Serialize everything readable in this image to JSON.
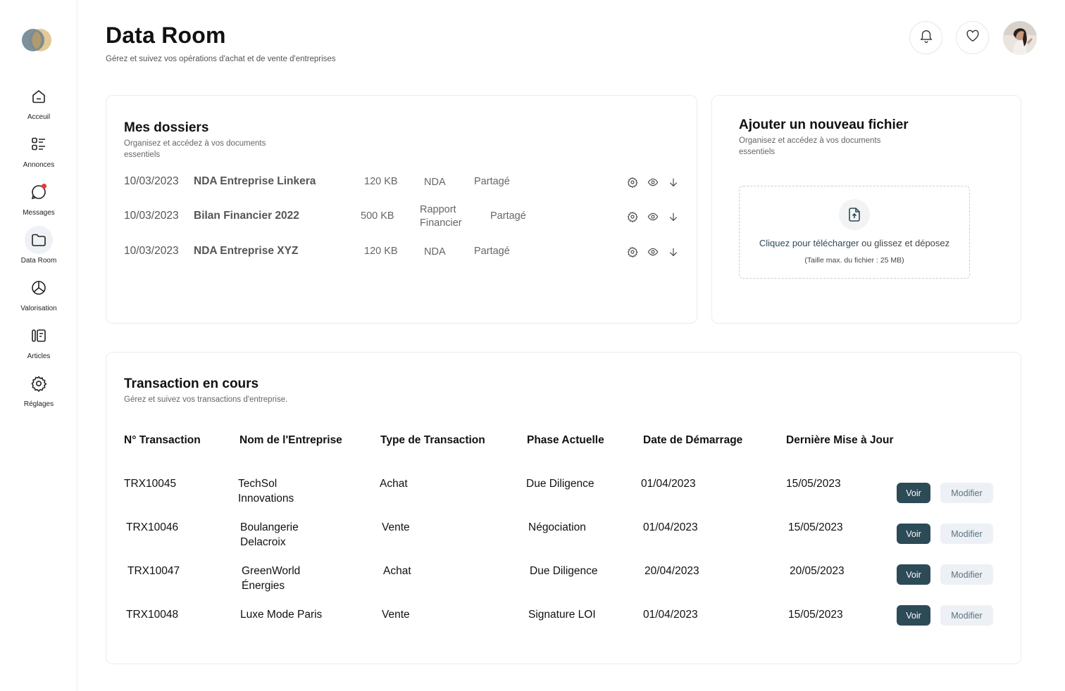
{
  "sidebar": {
    "items": [
      {
        "label": "Acceuil",
        "icon": "home-icon"
      },
      {
        "label": "Annonces",
        "icon": "list-icon"
      },
      {
        "label": "Messages",
        "icon": "chat-icon"
      },
      {
        "label": "Data Room",
        "icon": "folder-icon",
        "active": true
      },
      {
        "label": "Valorisation",
        "icon": "pie-chart-icon"
      },
      {
        "label": "Articles",
        "icon": "articles-icon"
      },
      {
        "label": "Réglages",
        "icon": "gear-icon"
      }
    ]
  },
  "header": {
    "title": "Data Room",
    "subtitle": "Gérez et suivez vos opérations d'achat et de vente d'entreprises"
  },
  "dossiers": {
    "title": "Mes dossiers",
    "subtitle_line1": "Organisez et accédez à vos documents",
    "subtitle_line2": "essentiels",
    "files": [
      {
        "date": "10/03/2023",
        "name": "NDA Entreprise Linkera",
        "size": "120 KB",
        "type": "NDA",
        "type_line2": "",
        "status": "Partagé"
      },
      {
        "date": "10/03/2023",
        "name": "Bilan Financier 2022",
        "size": "500 KB",
        "type": "Rapport",
        "type_line2": "Financier",
        "status": "Partagé"
      },
      {
        "date": "10/03/2023",
        "name": "NDA Entreprise XYZ",
        "size": "120 KB",
        "type": "NDA",
        "type_line2": "",
        "status": "Partagé"
      }
    ]
  },
  "upload": {
    "title": "Ajouter un nouveau fichier",
    "subtitle_line1": "Organisez et accédez à vos documents",
    "subtitle_line2": "essentiels",
    "link_text": "Cliquez pour télécharger",
    "rest_text": " ou glissez et déposez",
    "hint": "(Taille max. du fichier : 25 MB)"
  },
  "transactions": {
    "title": "Transaction en cours",
    "subtitle": "Gérez et suivez vos transactions d'entreprise.",
    "headers": [
      "N° Transaction",
      "Nom de l'Entreprise",
      "Type de Transaction",
      "Phase Actuelle",
      "Date de Démarrage",
      "Dernière Mise à Jour"
    ],
    "rows": [
      {
        "id": "TRX10045",
        "company": "TechSol",
        "company_line2": "Innovations",
        "type": "Achat",
        "phase": "Due Diligence",
        "start": "01/04/2023",
        "updated": "15/05/2023"
      },
      {
        "id": "TRX10046",
        "company": "Boulangerie",
        "company_line2": "Delacroix",
        "type": "Vente",
        "phase": "Négociation",
        "start": "01/04/2023",
        "updated": "15/05/2023"
      },
      {
        "id": "TRX10047",
        "company": "GreenWorld",
        "company_line2": "Énergies",
        "type": "Achat",
        "phase": "Due Diligence",
        "start": "20/04/2023",
        "updated": "20/05/2023"
      },
      {
        "id": "TRX10048",
        "company": "Luxe Mode Paris",
        "company_line2": "",
        "type": "Vente",
        "phase": "Signature LOI",
        "start": "01/04/2023",
        "updated": "15/05/2023"
      }
    ],
    "view_label": "Voir",
    "edit_label": "Modifier"
  },
  "colors": {
    "primary": "#2d4a57",
    "secondary_bg": "#edf1f5",
    "notification_dot": "#e5383b"
  }
}
